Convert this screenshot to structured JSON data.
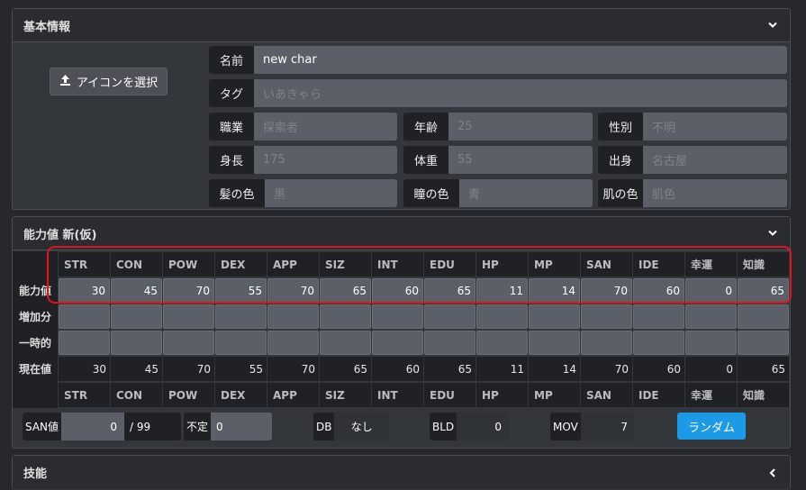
{
  "basic": {
    "title": "基本情報",
    "icon_button": "アイコンを選択",
    "name": {
      "label": "名前",
      "value": "new char"
    },
    "tag": {
      "label": "タグ",
      "placeholder": "いあきゃら"
    },
    "job": {
      "label": "職業",
      "placeholder": "探索者"
    },
    "age": {
      "label": "年齢",
      "placeholder": "25"
    },
    "sex": {
      "label": "性別",
      "placeholder": "不明"
    },
    "height": {
      "label": "身長",
      "placeholder": "175"
    },
    "weight": {
      "label": "体重",
      "placeholder": "55"
    },
    "origin": {
      "label": "出身",
      "placeholder": "名古屋"
    },
    "hair": {
      "label": "髪の色",
      "placeholder": "黒"
    },
    "eye": {
      "label": "瞳の色",
      "placeholder": "青"
    },
    "skin": {
      "label": "肌の色",
      "placeholder": "肌色"
    }
  },
  "stats": {
    "title": "能力値 新(仮)",
    "headers": [
      "STR",
      "CON",
      "POW",
      "DEX",
      "APP",
      "SIZ",
      "INT",
      "EDU",
      "HP",
      "MP",
      "SAN",
      "IDE",
      "幸運",
      "知識"
    ],
    "row_labels": {
      "ability": "能力値",
      "increase": "増加分",
      "temp": "一時的",
      "current": "現在値"
    },
    "ability": [
      "30",
      "45",
      "70",
      "55",
      "70",
      "65",
      "60",
      "65",
      "11",
      "14",
      "70",
      "60",
      "0",
      "65"
    ],
    "current": [
      "30",
      "45",
      "70",
      "55",
      "70",
      "65",
      "60",
      "65",
      "11",
      "14",
      "70",
      "60",
      "0",
      "65"
    ]
  },
  "summary": {
    "san_label": "SAN値",
    "san_value": "0",
    "san_max": "/ 99",
    "fuki_label": "不定",
    "fuki_value": "0",
    "db_label": "DB",
    "db_value": "なし",
    "bld_label": "BLD",
    "bld_value": "0",
    "mov_label": "MOV",
    "mov_value": "7",
    "random_button": "ランダム"
  },
  "skills": {
    "title": "技能"
  },
  "colors": {
    "accent": "#1d9ae6",
    "highlight": "#e1141e"
  }
}
